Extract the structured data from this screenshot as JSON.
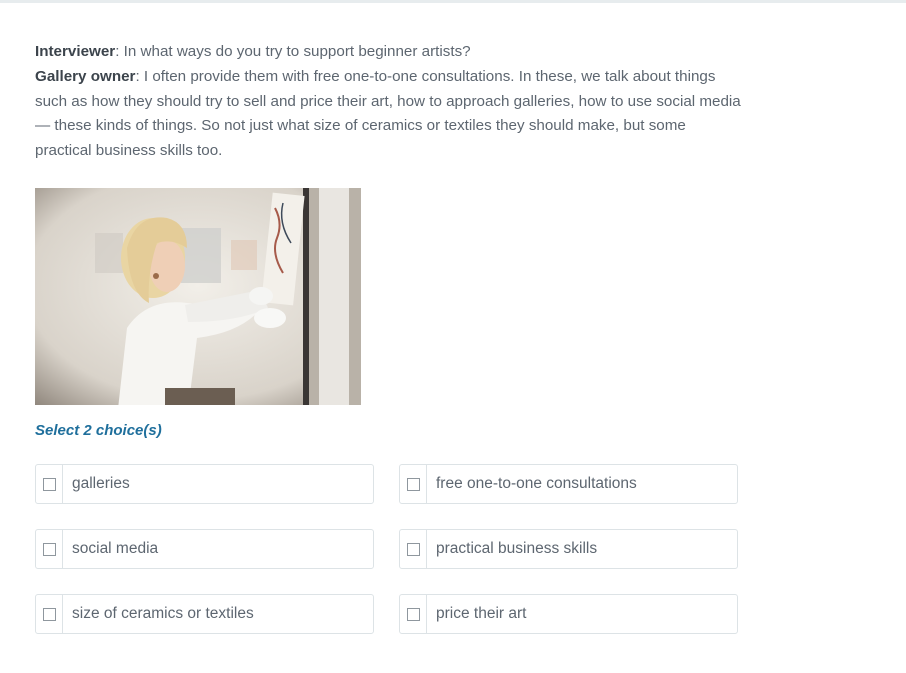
{
  "passage": {
    "lines": [
      {
        "speaker": "Interviewer",
        "text": ": In what ways do you try to support beginner artists?"
      },
      {
        "speaker": "Gallery owner",
        "text": ": I often provide them with free one-to-one consultations. In these, we talk about things such as how they should try to sell and price their art, how to approach galleries, how to use social media — these kinds of things. So not just what size of ceramics or textiles they should make, but some practical business skills too."
      }
    ]
  },
  "instruction": "Select 2 choice(s)",
  "options": [
    {
      "label": "galleries",
      "checked": false
    },
    {
      "label": "free one-to-one consultations",
      "checked": false
    },
    {
      "label": "social media",
      "checked": false
    },
    {
      "label": "practical business skills",
      "checked": false
    },
    {
      "label": "size of ceramics or textiles",
      "checked": false
    },
    {
      "label": "price their art",
      "checked": false
    }
  ],
  "icons": {
    "checkbox": "checkbox-empty-icon"
  },
  "colors": {
    "instruction": "#1f6f9c",
    "text": "#5d6670",
    "border": "#dde3e6"
  }
}
